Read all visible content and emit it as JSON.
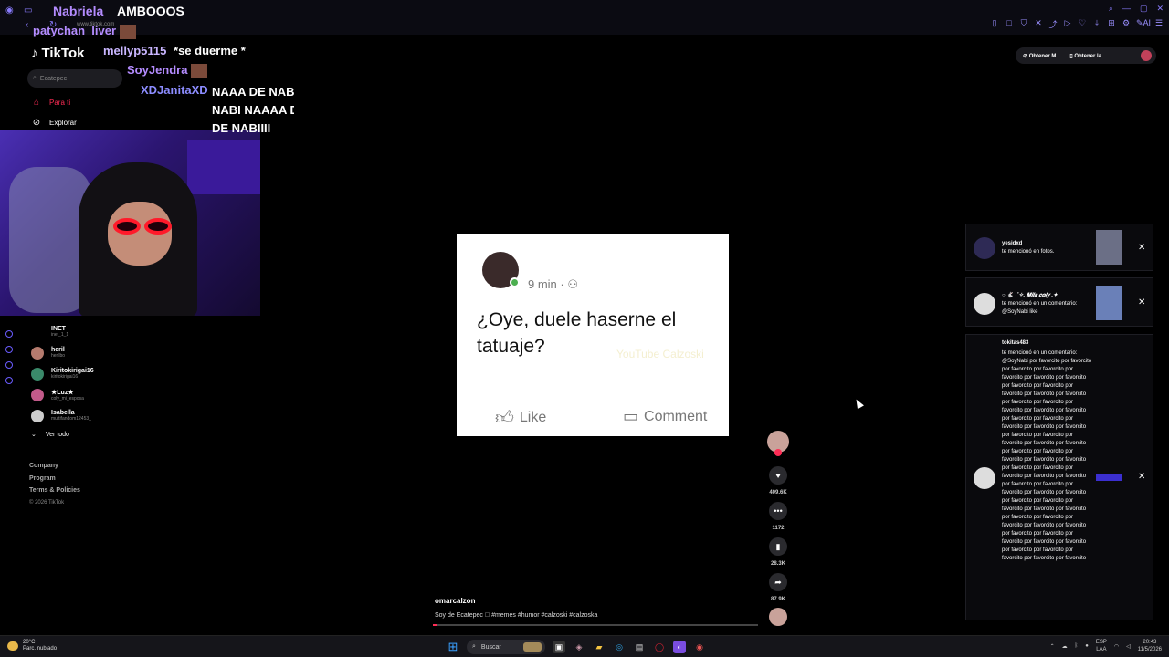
{
  "browser": {
    "tab_label": "Nabriela",
    "address": "www.tiktok.com",
    "right_tool_icons": [
      "bookmark-icon",
      "square-icon",
      "shield-icon",
      "translate-icon",
      "share-icon",
      "play-icon",
      "heart-icon",
      "download-icon",
      "cart-icon",
      "settings-icon",
      "ai-icon",
      "menu-icon"
    ]
  },
  "chat": {
    "lines": [
      {
        "user": "AMBOOOS",
        "color": "#ffffff"
      },
      {
        "user": "patychan_liver",
        "color": "#b48cff"
      },
      {
        "user": "mellyp5115",
        "message": "*se duerme *",
        "color": "#c9b6ff"
      },
      {
        "user": "SoyJendra",
        "color": "#b48cff"
      },
      {
        "user": "XDJanitaXD",
        "message_lines": [
          "NAAA DE NABI",
          "NABI NAAAA D",
          "DE NABIIII"
        ],
        "color": "#8c8cff"
      }
    ]
  },
  "tiktok": {
    "logo": "TikTok",
    "search_placeholder": "Ecatepec",
    "nav": {
      "for_you": "Para ti",
      "explore": "Explorar"
    },
    "following": [
      {
        "name": "INET",
        "handle": "inet_1_1"
      },
      {
        "name": "heril",
        "handle": "herilbo"
      },
      {
        "name": "Kiritokirigai16",
        "handle": "kiritokirigai16"
      },
      {
        "name": "★Luz★",
        "handle": "coly_mi_esposa"
      },
      {
        "name": "Isabella",
        "handle": "multifandom12453_"
      }
    ],
    "see_all": "Ver todo",
    "footer": {
      "company": "Company",
      "program": "Program",
      "terms": "Terms & Policies",
      "copyright": "© 2026 TikTok"
    }
  },
  "video": {
    "post_time": "9 min",
    "post_text": "¿Oye, duele haserne el tatuaje?",
    "watermark": "YouTube Calzoski",
    "like_label": "Like",
    "comment_label": "Comment",
    "likes": "409.6K",
    "comments": "1172",
    "saves": "28.3K",
    "shares": "87.9K",
    "author": "omarcalzon",
    "caption": "Soy de Ecatepec 🏻 #memes #humor #calzoski #calzoska",
    "progress": 0.01
  },
  "top_actions": {
    "get_app": "Obtener M...",
    "get_pc": "Obtener la ..."
  },
  "notifications": [
    {
      "user": "yesidxd",
      "body": "te mencionó en fotos."
    },
    {
      "user": "○ 🐇 ·˚✧. 𝑴𝒊𝒍𝒂 𝒄𝒐𝒍𝒚 .✦",
      "body": "te mencionó en un comentario: @SoyNabi like"
    },
    {
      "user": "tokitas483",
      "body": "te mencionó en un comentario: @SoyNabi por favorcito por favorcito por favorcito por favorcito por favorcito por favorcito por favorcito por favorcito por favorcito por favorcito por favorcito por favorcito por favorcito por favorcito por favorcito por favorcito por favorcito por favorcito por favorcito por favorcito por favorcito por favorcito por favorcito por favorcito por favorcito por favorcito por favorcito por favorcito por favorcito por favorcito por favorcito por favorcito por favorcito por favorcito por favorcito por favorcito por favorcito por favorcito por favorcito por favorcito por favorcito por favorcito por favorcito por favorcito por favorcito por favorcito por favorcito por favorcito por favorcito por favorcito por favorcito por favorcito por favorcito por favorcito por favorcito por favorcito por favorcito por favorcito por favorcito por favorcito por favorcito por favorcito"
    }
  ],
  "taskbar": {
    "temp": "20°C",
    "weather": "Parc. nublado",
    "search": "Buscar",
    "lang": "ESP",
    "lang2": "LAA",
    "time": "20:43",
    "date": "11/5/2026"
  },
  "colors": {
    "accent": "#fe2c55",
    "chrome_accent": "#8a7cff"
  }
}
